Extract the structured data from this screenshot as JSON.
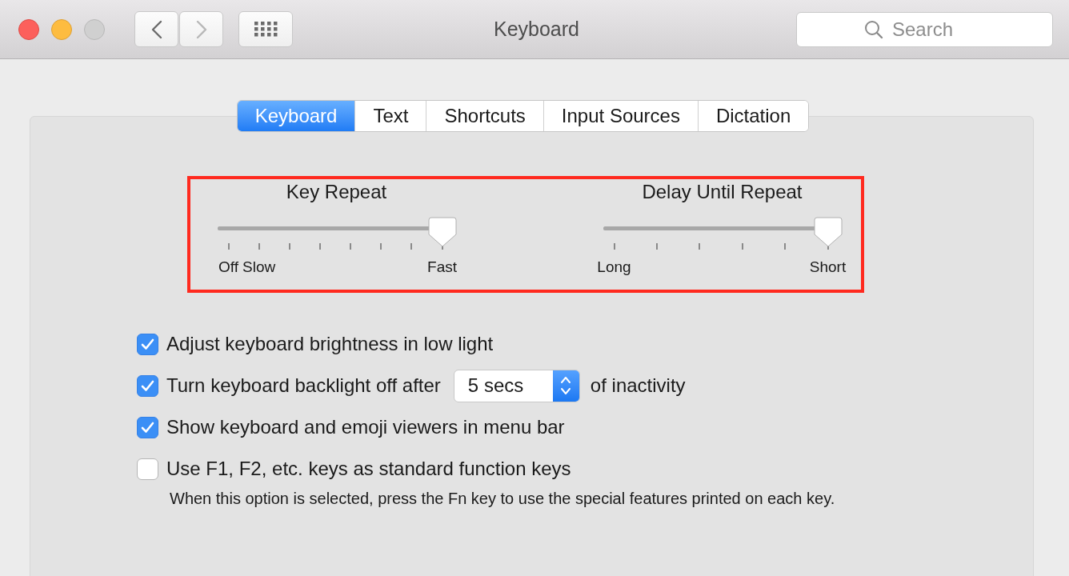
{
  "window": {
    "title": "Keyboard",
    "controls": [
      {
        "kind": "close",
        "disabled": false
      },
      {
        "kind": "minimize",
        "disabled": false
      },
      {
        "kind": "zoom",
        "disabled": true
      }
    ]
  },
  "toolbar": {
    "back": {
      "disabled": false
    },
    "forward": {
      "disabled": true
    }
  },
  "search": {
    "placeholder": "Search"
  },
  "tabs": [
    {
      "label": "Keyboard",
      "selected": true
    },
    {
      "label": "Text",
      "selected": false
    },
    {
      "label": "Shortcuts",
      "selected": false
    },
    {
      "label": "Input Sources",
      "selected": false
    },
    {
      "label": "Dictation",
      "selected": false
    }
  ],
  "sliders": [
    {
      "title": "Key Repeat",
      "level": 1,
      "labels": [
        "Off",
        "Slow",
        "Fast"
      ]
    },
    {
      "title": "Delay Until Repeat",
      "level": 1,
      "labels": [
        "Long",
        "Short"
      ]
    }
  ],
  "options": [
    {
      "kind": "check",
      "label": "Adjust keyboard brightness in low light",
      "checked": true
    },
    {
      "kind": "check_select",
      "label": "Turn keyboard backlight off after",
      "checked": true,
      "select": "5 secs",
      "suffix": "of inactivity"
    },
    {
      "kind": "check",
      "label": "Show keyboard and emoji viewers in menu bar",
      "checked": true
    },
    {
      "kind": "check_note",
      "label": "Use F1, F2, etc. keys as standard function keys",
      "checked": false,
      "note": "When this option is selected, press the Fn key to use the special features printed on each key."
    }
  ]
}
